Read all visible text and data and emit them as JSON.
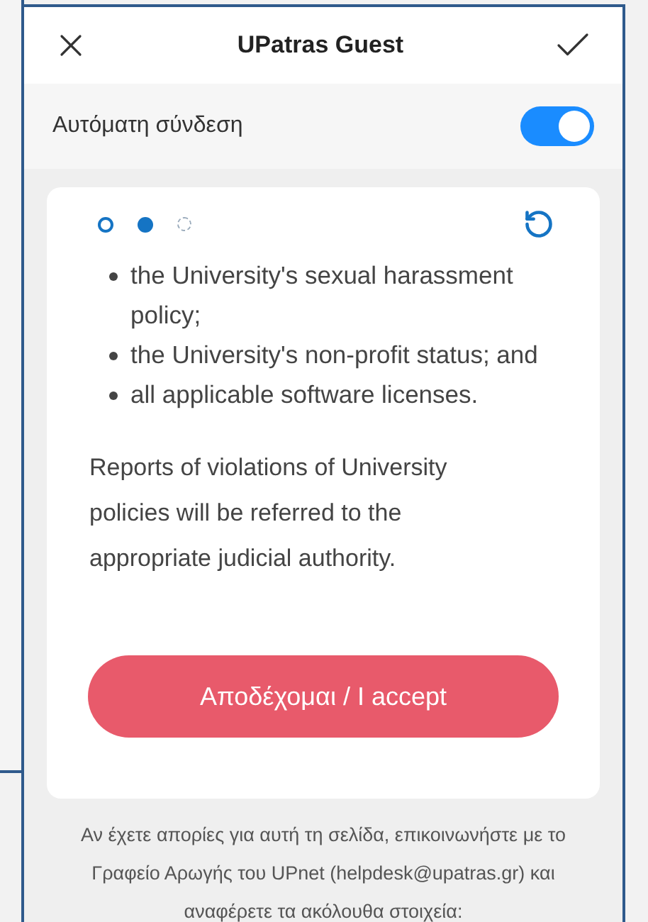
{
  "header": {
    "title": "UPatras Guest"
  },
  "auto_connect": {
    "label": "Αυτόματη σύνδεση",
    "on": true
  },
  "pager": [
    {
      "selected": false,
      "visited": true
    },
    {
      "selected": true,
      "visited": true
    },
    {
      "selected": false,
      "visited": false
    }
  ],
  "bullets": [
    "the University's sexual harassment policy;",
    "the University's non-profit status; and",
    "all applicable software licenses."
  ],
  "paragraph": "Reports of violations of University policies will be referred to the appropriate judicial authority.",
  "accept_button": "Αποδέχομαι / I accept",
  "footer": "Αν έχετε απορίες για αυτή τη σελίδα, επικοινωνήστε με το Γραφείο Αρωγής του UPnet (helpdesk@upatras.gr) και αναφέρετε τα ακόλουθα στοιχεία:"
}
